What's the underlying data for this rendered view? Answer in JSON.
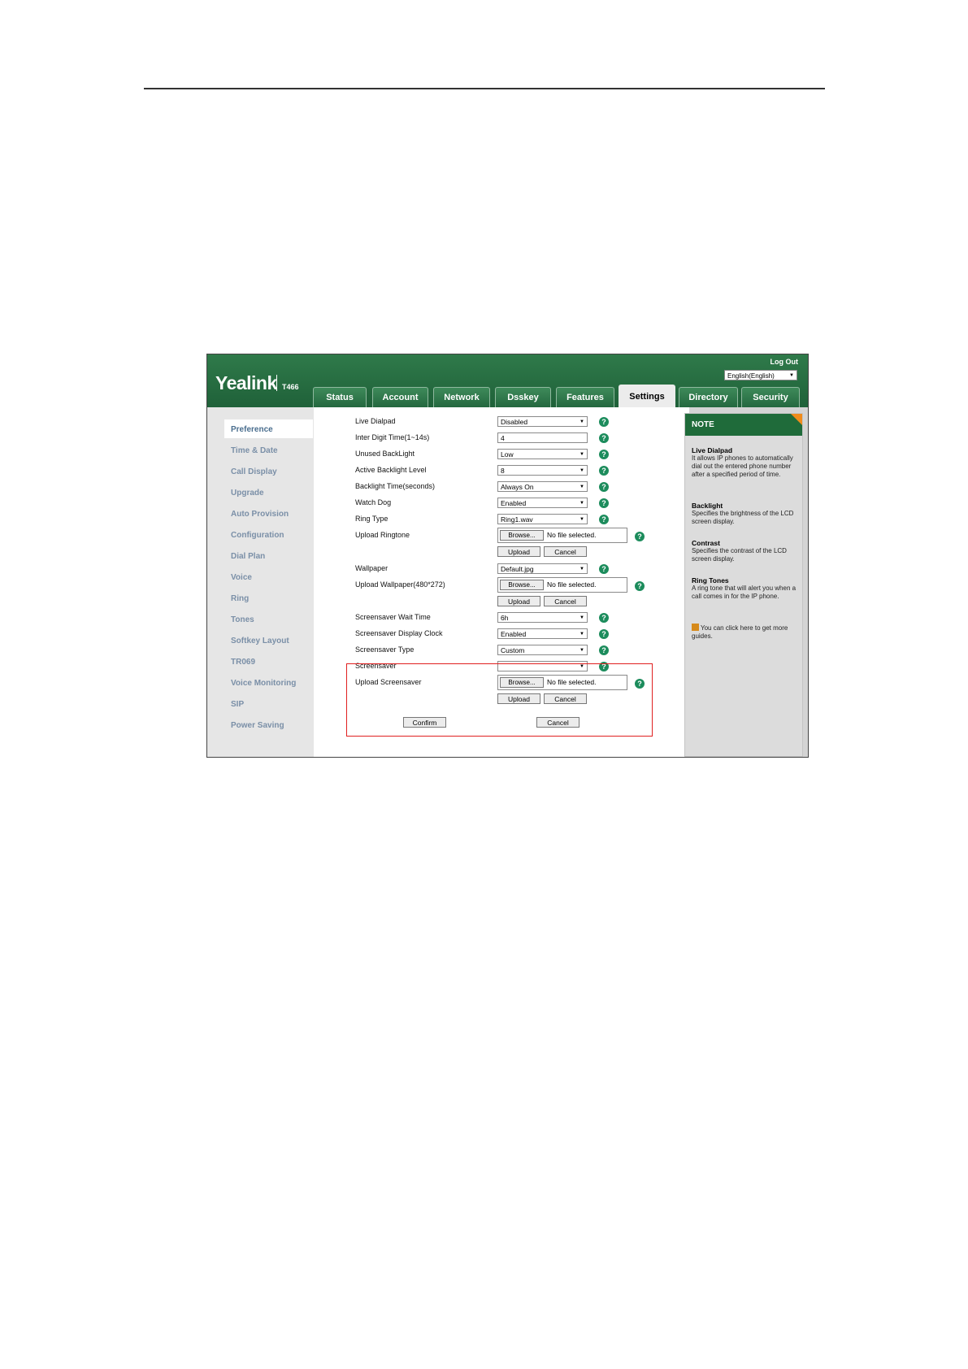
{
  "app": {
    "logo": "Yealink",
    "model": "T466",
    "logout": "Log Out",
    "language": "English(English)"
  },
  "tabs": [
    "Status",
    "Account",
    "Network",
    "Dsskey",
    "Features",
    "Settings",
    "Directory",
    "Security"
  ],
  "active_tab": "Settings",
  "sidebar": [
    "Preference",
    "Time & Date",
    "Call Display",
    "Upgrade",
    "Auto Provision",
    "Configuration",
    "Dial Plan",
    "Voice",
    "Ring",
    "Tones",
    "Softkey Layout",
    "TR069",
    "Voice Monitoring",
    "SIP",
    "Power Saving"
  ],
  "active_sidebar": "Preference",
  "form": {
    "live_dialpad": {
      "label": "Live Dialpad",
      "value": "Disabled"
    },
    "inter_digit": {
      "label": "Inter Digit Time(1~14s)",
      "value": "4"
    },
    "unused_backlight": {
      "label": "Unused BackLight",
      "value": "Low"
    },
    "active_backlight": {
      "label": "Active Backlight Level",
      "value": "8"
    },
    "backlight_time": {
      "label": "Backlight Time(seconds)",
      "value": "Always On"
    },
    "watch_dog": {
      "label": "Watch Dog",
      "value": "Enabled"
    },
    "ring_type": {
      "label": "Ring Type",
      "value": "Ring1.wav"
    },
    "upload_ringtone": {
      "label": "Upload Ringtone"
    },
    "wallpaper": {
      "label": "Wallpaper",
      "value": "Default.jpg"
    },
    "upload_wallpaper": {
      "label": "Upload Wallpaper(480*272)"
    },
    "screensaver_wait": {
      "label": "Screensaver Wait Time",
      "value": "6h"
    },
    "screensaver_clock": {
      "label": "Screensaver Display Clock",
      "value": "Enabled"
    },
    "screensaver_type": {
      "label": "Screensaver Type",
      "value": "Custom"
    },
    "screensaver": {
      "label": "Screensaver",
      "value": ""
    },
    "upload_screensaver": {
      "label": "Upload Screensaver"
    }
  },
  "file": {
    "browse": "Browse...",
    "no_file": "No file selected.",
    "upload": "Upload",
    "cancel": "Cancel"
  },
  "footer": {
    "confirm": "Confirm",
    "cancel": "Cancel"
  },
  "note": {
    "header": "NOTE",
    "items": [
      {
        "title": "Live Dialpad",
        "text": "It allows IP phones to automatically dial out the entered phone number after a specified period of time."
      },
      {
        "title": "Backlight",
        "text": "Specifies the brightness of the LCD screen display."
      },
      {
        "title": "Contrast",
        "text": "Specifies the contrast of the LCD screen display."
      },
      {
        "title": "Ring Tones",
        "text": "A ring tone that will alert you when a call comes in for the IP phone."
      }
    ],
    "guide": "You can click here to get more guides."
  },
  "colors": {
    "header_green": "#1f6139",
    "help_green": "#1c8c5c",
    "highlight_red": "#e02020",
    "note_orange": "#f08c1c"
  }
}
